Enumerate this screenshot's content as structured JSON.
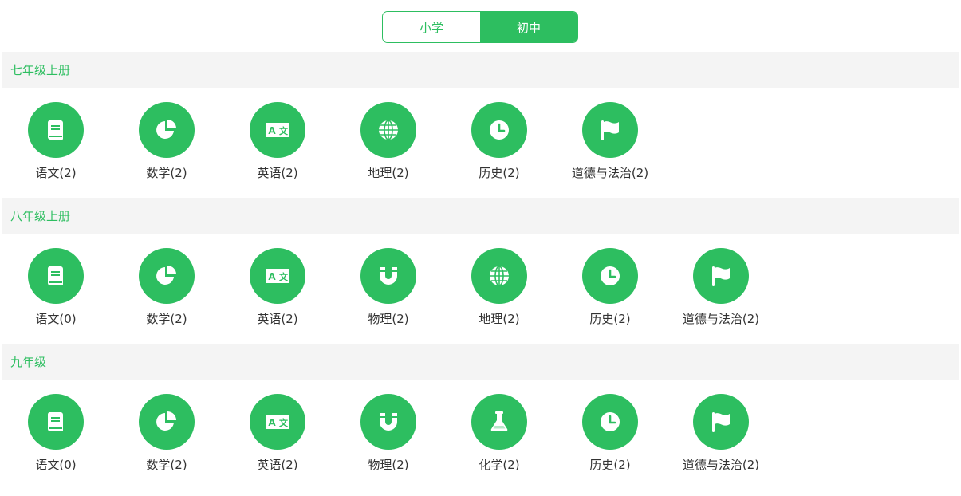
{
  "tabs": [
    {
      "label": "小学",
      "active": false
    },
    {
      "label": "初中",
      "active": true
    }
  ],
  "sections": [
    {
      "title": "七年级上册",
      "subjects": [
        {
          "label": "语文(2)",
          "icon": "book-icon"
        },
        {
          "label": "数学(2)",
          "icon": "pie-chart-icon"
        },
        {
          "label": "英语(2)",
          "icon": "translate-icon"
        },
        {
          "label": "地理(2)",
          "icon": "globe-icon"
        },
        {
          "label": "历史(2)",
          "icon": "clock-icon"
        },
        {
          "label": "道德与法治(2)",
          "icon": "flag-icon"
        }
      ]
    },
    {
      "title": "八年级上册",
      "subjects": [
        {
          "label": "语文(0)",
          "icon": "book-icon"
        },
        {
          "label": "数学(2)",
          "icon": "pie-chart-icon"
        },
        {
          "label": "英语(2)",
          "icon": "translate-icon"
        },
        {
          "label": "物理(2)",
          "icon": "magnet-icon"
        },
        {
          "label": "地理(2)",
          "icon": "globe-icon"
        },
        {
          "label": "历史(2)",
          "icon": "clock-icon"
        },
        {
          "label": "道德与法治(2)",
          "icon": "flag-icon"
        }
      ]
    },
    {
      "title": "九年级",
      "subjects": [
        {
          "label": "语文(0)",
          "icon": "book-icon"
        },
        {
          "label": "数学(2)",
          "icon": "pie-chart-icon"
        },
        {
          "label": "英语(2)",
          "icon": "translate-icon"
        },
        {
          "label": "物理(2)",
          "icon": "magnet-icon"
        },
        {
          "label": "化学(2)",
          "icon": "flask-icon"
        },
        {
          "label": "历史(2)",
          "icon": "clock-icon"
        },
        {
          "label": "道德与法治(2)",
          "icon": "flag-icon"
        }
      ]
    }
  ],
  "colors": {
    "accent": "#2dbe60",
    "header_bg": "#f4f4f4",
    "text": "#333333"
  }
}
